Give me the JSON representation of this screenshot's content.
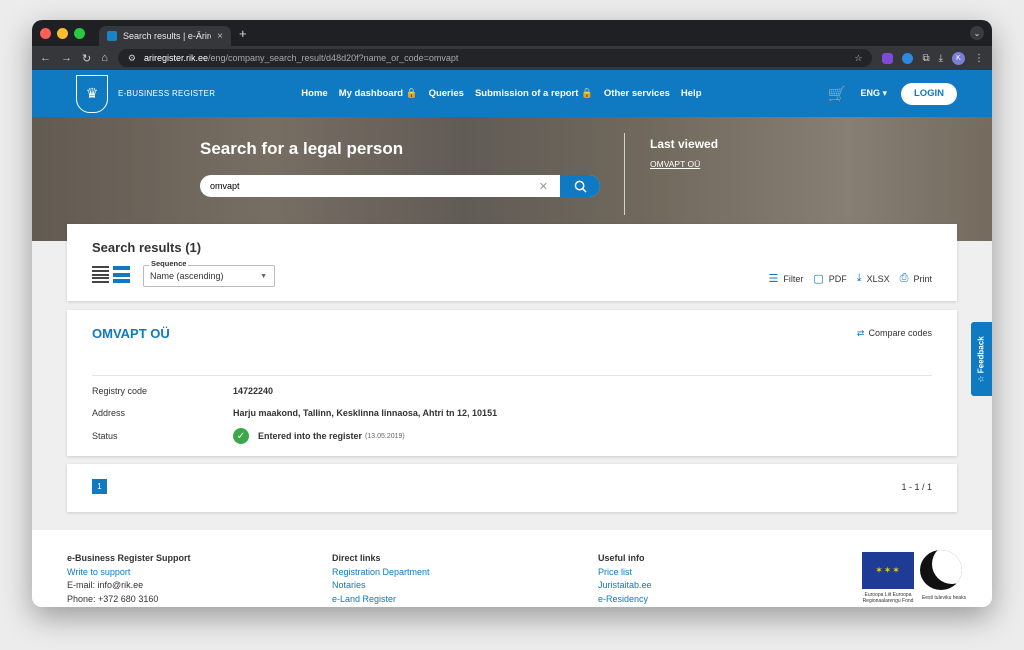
{
  "browser": {
    "tab_title": "Search results | e-Äriregister",
    "tab_close": "×",
    "new_tab": "+",
    "url_host": "ariregister.rik.ee",
    "url_path": "/eng/company_search_result/d48d20f?name_or_code=omvapt",
    "profile_letter": "K"
  },
  "header": {
    "brand": "E-BUSINESS REGISTER",
    "menu": [
      "Home",
      "My dashboard 🔒",
      "Queries",
      "Submission of a report 🔒",
      "Other services",
      "Help"
    ],
    "lang": "ENG ▾",
    "login": "LOGIN"
  },
  "hero": {
    "title": "Search for a legal person",
    "search_value": "omvapt",
    "last_viewed_title": "Last viewed",
    "last_viewed_item": "OMVAPT OÜ"
  },
  "results": {
    "title": "Search results (1)",
    "sequence_label": "Sequence",
    "sequence_value": "Name (ascending)",
    "tools": {
      "filter": "Filter",
      "pdf": "PDF",
      "xlsx": "XLSX",
      "print": "Print"
    }
  },
  "company": {
    "name": "OMVAPT OÜ",
    "compare": "Compare codes",
    "rows": [
      {
        "label": "Registry code",
        "value": "14722240"
      },
      {
        "label": "Address",
        "value": "Harju maakond, Tallinn, Kesklinna linnaosa, Ahtri tn 12, 10151"
      },
      {
        "label": "Status",
        "value": "Entered into the register",
        "date": "(13.05.2019)"
      }
    ]
  },
  "pager": {
    "current": "1",
    "range": "1 - 1 / 1"
  },
  "footer": {
    "col1": {
      "title": "e-Business Register Support",
      "link": "Write to support",
      "email": "E-mail: info@rik.ee",
      "phone": "Phone: +372 680 3160"
    },
    "col2": {
      "title": "Direct links",
      "links": [
        "Registration Department",
        "Notaries",
        "e-Land Register"
      ]
    },
    "col3": {
      "title": "Useful info",
      "links": [
        "Price list",
        "Juristaitab.ee",
        "e-Residency"
      ]
    },
    "eu_caption": "Euroopa Liit Euroopa Regionaalarengu Fond",
    "ee_caption": "Eesti tuleviku heaks"
  },
  "feedback": "☆ Feedback",
  "colors": {
    "brand_blue": "#0f79c2",
    "status_green": "#3ca84a"
  }
}
